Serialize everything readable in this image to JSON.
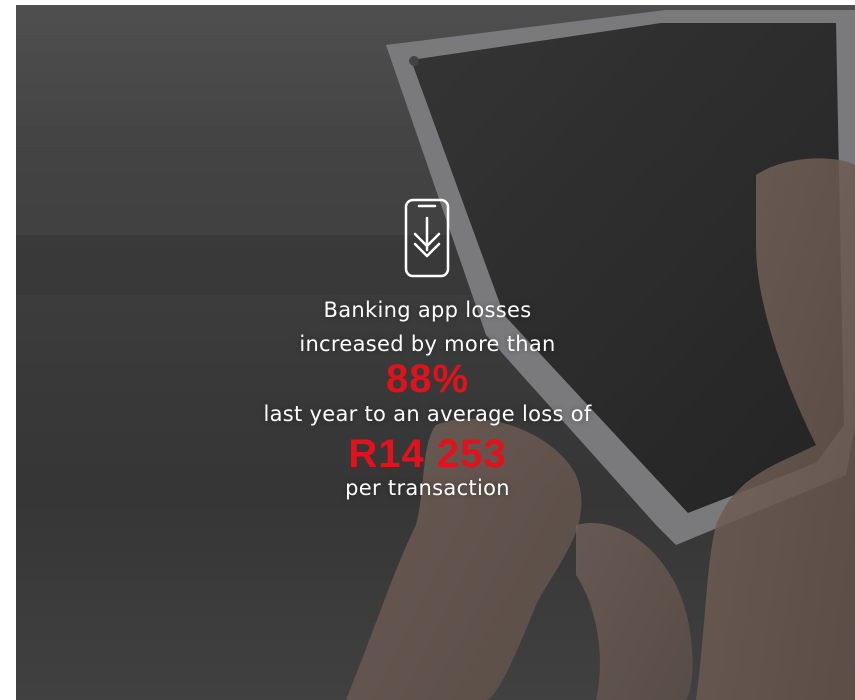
{
  "stat": {
    "icon": "phone-download-icon",
    "line1": "Banking app losses",
    "line2": "increased by more than",
    "percent": "88%",
    "line3": "last year to an average loss of",
    "amount": "R14 253",
    "line4": "per transaction"
  },
  "colors": {
    "accent": "#e3111b",
    "text": "#ffffff",
    "overlay": "#3a3a3a"
  }
}
